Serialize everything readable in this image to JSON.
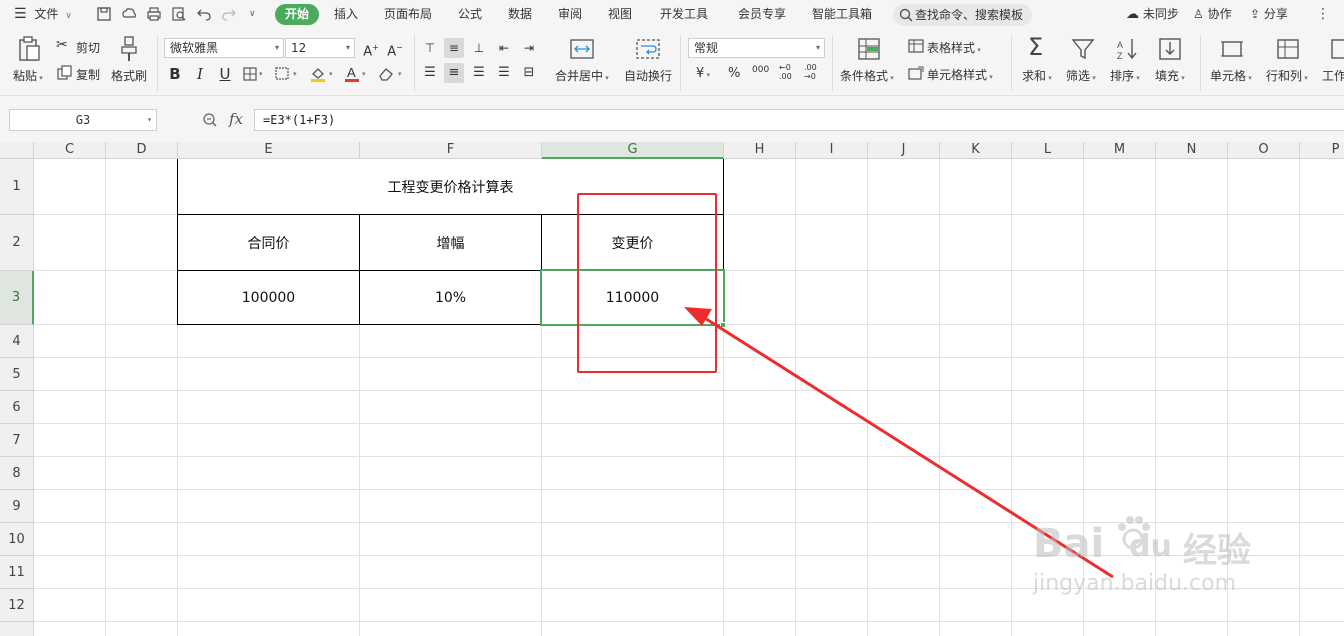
{
  "menubar": {
    "file_label": "文件",
    "tabs": [
      {
        "label": "开始",
        "active": true
      },
      {
        "label": "插入"
      },
      {
        "label": "页面布局"
      },
      {
        "label": "公式"
      },
      {
        "label": "数据"
      },
      {
        "label": "审阅"
      },
      {
        "label": "视图"
      },
      {
        "label": "开发工具"
      },
      {
        "label": "会员专享"
      },
      {
        "label": "智能工具箱"
      }
    ],
    "search_placeholder": "查找命令、搜索模板",
    "sync_label": "未同步",
    "collab_label": "协作",
    "share_label": "分享"
  },
  "ribbon": {
    "paste_label": "粘贴",
    "cut_label": "剪切",
    "copy_label": "复制",
    "format_painter_label": "格式刷",
    "font_name": "微软雅黑",
    "font_size": "12",
    "merge_center_label": "合并居中",
    "wrap_text_label": "自动换行",
    "number_format": "常规",
    "conditional_format_label": "条件格式",
    "table_style_label": "表格样式",
    "cell_style_label": "单元格样式",
    "sum_label": "求和",
    "filter_label": "筛选",
    "sort_label": "排序",
    "fill_label": "填充",
    "cell_label": "单元格",
    "row_col_label": "行和列",
    "worksheet_label": "工作",
    "bold": "B",
    "italic": "I",
    "underline": "U",
    "currency_symbol": "¥",
    "percent_symbol": "%",
    "thousands_symbol": "000"
  },
  "formula_bar": {
    "cell_ref": "G3",
    "fx_label": "fx",
    "formula": "=E3*(1+F3)"
  },
  "columns": [
    "C",
    "D",
    "E",
    "F",
    "G",
    "H",
    "I",
    "J",
    "K",
    "L",
    "M",
    "N",
    "O",
    "P"
  ],
  "rows": [
    "1",
    "2",
    "3",
    "4",
    "5",
    "6",
    "7",
    "8",
    "9",
    "10",
    "11",
    "12"
  ],
  "selected_column": "G",
  "selected_row": "3",
  "table": {
    "title": "工程变更价格计算表",
    "headers": [
      "合同价",
      "增幅",
      "变更价"
    ],
    "values": [
      "100000",
      "10%",
      "110000"
    ]
  },
  "watermark": {
    "brand": "Bai",
    "brand_suffix": "du",
    "cn_label": "经验",
    "url": "jingyan.baidu.com"
  },
  "colors": {
    "accent": "#4caa5e",
    "annotation": "#ee2c2c"
  }
}
